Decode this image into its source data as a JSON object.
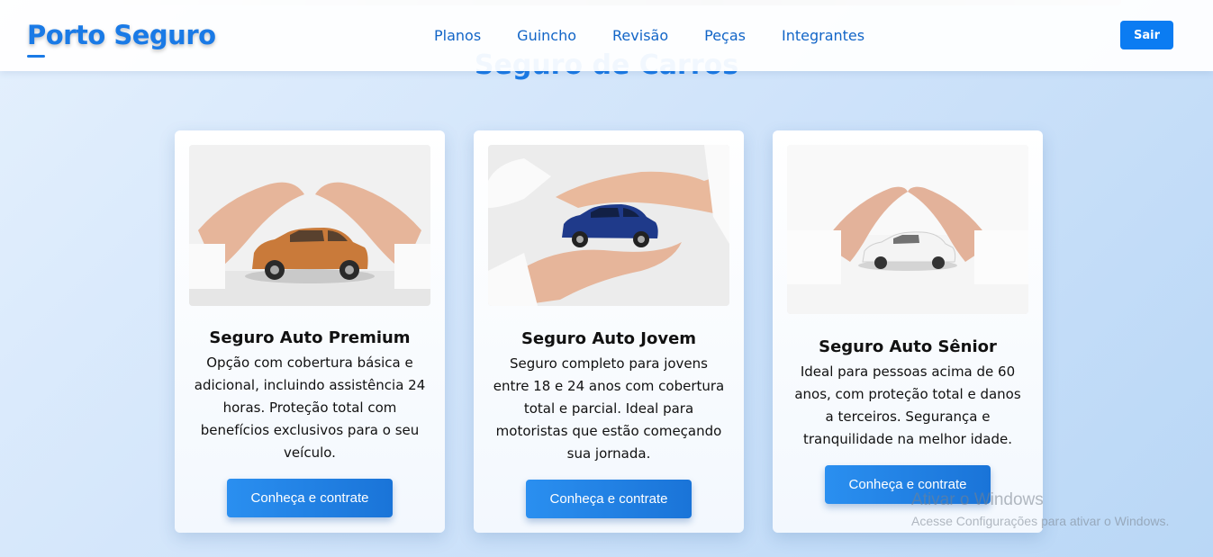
{
  "header": {
    "logo": "Porto Seguro",
    "nav": [
      "Planos",
      "Guincho",
      "Revisão",
      "Peças",
      "Integrantes"
    ],
    "logout_label": "Sair"
  },
  "main": {
    "section_title": "Seguro de Carros",
    "cards": [
      {
        "title": "Seguro Auto Premium",
        "description": "Opção com cobertura básica e adicional, incluindo assistência 24 horas. Proteção total com benefícios exclusivos para o seu veículo.",
        "button": "Conheça e contrate",
        "car_color": "#c97a3a"
      },
      {
        "title": "Seguro Auto Jovem",
        "description": "Seguro completo para jovens entre 18 e 24 anos com cobertura total e parcial. Ideal para motoristas que estão começando sua jornada.",
        "button": "Conheça e contrate",
        "car_color": "#1f3a8a"
      },
      {
        "title": "Seguro Auto Sênior",
        "description": "Ideal para pessoas acima de 60 anos, com proteção total e danos a terceiros. Segurança e tranquilidade na melhor idade.",
        "button": "Conheça e contrate",
        "car_color": "#f4f4f4"
      }
    ]
  },
  "watermark": {
    "title": "Ativar o Windows",
    "subtitle": "Acesse Configurações para ativar o Windows."
  },
  "colors": {
    "brand": "#1a7ae6",
    "button": "#0b7cf2"
  }
}
